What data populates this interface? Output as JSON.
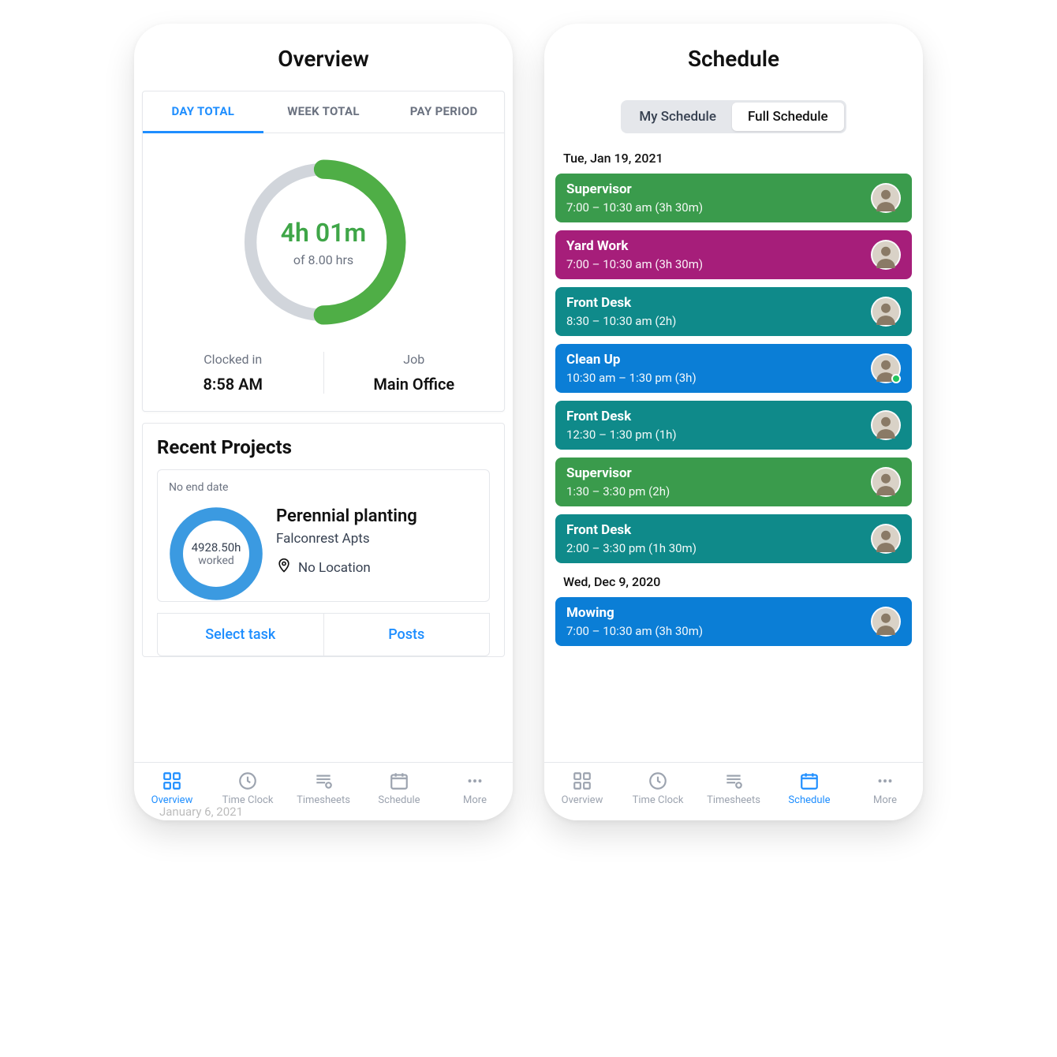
{
  "phone1": {
    "title": "Overview",
    "tabs": {
      "day": "DAY TOTAL",
      "week": "WEEK TOTAL",
      "payperiod": "PAY PERIOD"
    },
    "donut": {
      "value": "4h 01m",
      "sub": "of 8.00 hrs"
    },
    "stats": {
      "clocked_in_label": "Clocked in",
      "clocked_in_value": "8:58 AM",
      "job_label": "Job",
      "job_value": "Main Office"
    },
    "recent": {
      "title": "Recent Projects",
      "no_end": "No end date",
      "hours": "4928.50h",
      "worked": "worked",
      "project_name": "Perennial planting",
      "client": "Falconrest Apts",
      "location": "No Location",
      "action1": "Select task",
      "action2": "Posts"
    },
    "bottom_date": "January 6, 2021",
    "nav": {
      "overview": "Overview",
      "timeclock": "Time Clock",
      "timesheets": "Timesheets",
      "schedule": "Schedule",
      "more": "More"
    }
  },
  "phone2": {
    "title": "Schedule",
    "seg": {
      "my": "My Schedule",
      "full": "Full Schedule"
    },
    "day1": {
      "date": "Tue, Jan 19, 2021",
      "shifts": [
        {
          "title": "Supervisor",
          "time": "7:00 – 10:30 am (3h 30m)",
          "color": "#3a9b4c"
        },
        {
          "title": "Yard Work",
          "time": "7:00 – 10:30 am (3h 30m)",
          "color": "#a61e7a"
        },
        {
          "title": "Front Desk",
          "time": "8:30 – 10:30 am (2h)",
          "color": "#0f8a8a"
        },
        {
          "title": "Clean Up",
          "time": "10:30 am – 1:30 pm (3h)",
          "color": "#0b7ed6"
        },
        {
          "title": "Front Desk",
          "time": "12:30 – 1:30 pm (1h)",
          "color": "#0f8a8a"
        },
        {
          "title": "Supervisor",
          "time": "1:30 – 3:30 pm (2h)",
          "color": "#3a9b4c"
        },
        {
          "title": "Front Desk",
          "time": "2:00 – 3:30 pm (1h 30m)",
          "color": "#0f8a8a"
        }
      ]
    },
    "day2": {
      "date": "Wed, Dec 9, 2020",
      "shifts": [
        {
          "title": "Mowing",
          "time": "7:00 – 10:30 am (3h 30m)",
          "color": "#0b7ed6"
        }
      ]
    },
    "nav": {
      "overview": "Overview",
      "timeclock": "Time Clock",
      "timesheets": "Timesheets",
      "schedule": "Schedule",
      "more": "More"
    }
  }
}
